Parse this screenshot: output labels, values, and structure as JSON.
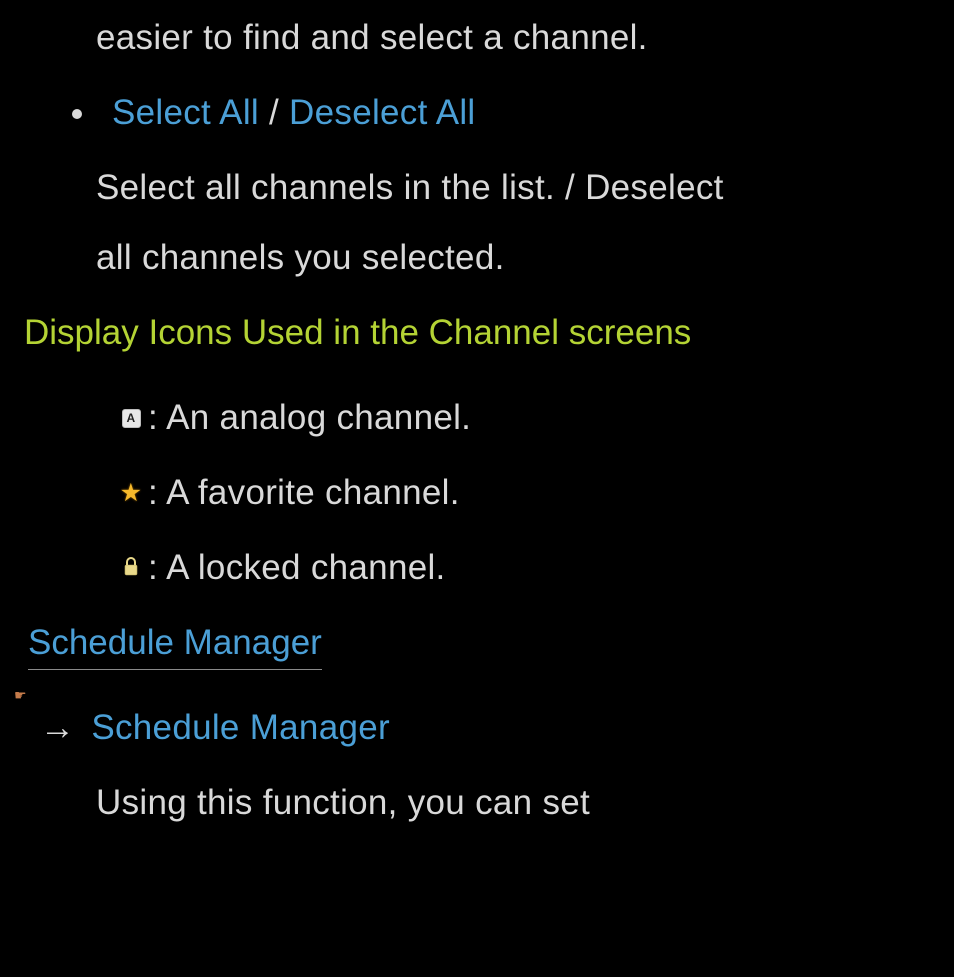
{
  "top_fragment": "easier to find and select a channel.",
  "bullet": {
    "select_all": "Select All",
    "sep": " / ",
    "deselect_all": "Deselect All",
    "desc_line1": "Select all channels in the list. / Deselect",
    "desc_line2": "all channels you selected."
  },
  "icons_heading": "Display Icons Used in the Channel screens",
  "icons": {
    "analog_letter": "A",
    "analog_desc": ": An analog channel.",
    "favorite_desc": ": A favorite channel.",
    "locked_desc": ": A locked channel."
  },
  "schedule": {
    "title": "Schedule Manager",
    "arrow": "→",
    "nav_label": "Schedule Manager",
    "body": "Using this function, you can set"
  }
}
